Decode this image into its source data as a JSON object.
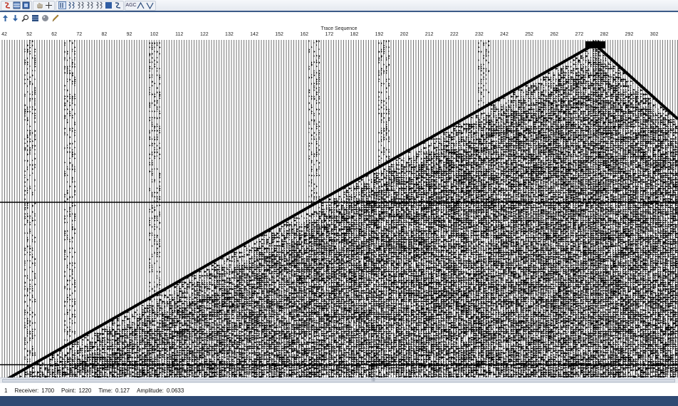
{
  "toolbar_top": {
    "items": [
      {
        "name": "seismic-display-icon",
        "kind": "icon"
      },
      {
        "name": "table-view-icon",
        "kind": "icon"
      },
      {
        "name": "data-view-icon",
        "kind": "icon"
      },
      {
        "name": "pan-hand-icon",
        "kind": "icon"
      },
      {
        "name": "crosshair-icon",
        "kind": "icon"
      },
      {
        "name": "wiggle-mode-1-icon",
        "kind": "icon"
      },
      {
        "name": "wiggle-mode-2-icon",
        "kind": "icon"
      },
      {
        "name": "wiggle-mode-3-icon",
        "kind": "icon"
      },
      {
        "name": "wiggle-mode-4-icon",
        "kind": "icon"
      },
      {
        "name": "wiggle-mode-5-icon",
        "kind": "icon"
      },
      {
        "name": "wiggle-mode-6-icon",
        "kind": "icon"
      },
      {
        "name": "wiggle-mode-7-icon",
        "kind": "icon"
      },
      {
        "name": "agc-icon",
        "kind": "icon"
      },
      {
        "name": "peak-icon",
        "kind": "icon"
      },
      {
        "name": "trough-icon",
        "kind": "icon"
      }
    ],
    "agc_label": "AGC"
  },
  "toolbar_second": {
    "items": [
      {
        "name": "increase-gain-icon"
      },
      {
        "name": "decrease-gain-icon"
      },
      {
        "name": "zoom-icon"
      },
      {
        "name": "layers-icon"
      },
      {
        "name": "palette-icon"
      },
      {
        "name": "pencil-icon"
      }
    ]
  },
  "plot": {
    "axis_title": "Trace Sequence",
    "tick_labels": [
      "42",
      "52",
      "62",
      "72",
      "82",
      "92",
      "102",
      "112",
      "122",
      "132",
      "142",
      "152",
      "162",
      "172",
      "182",
      "192",
      "202",
      "212",
      "222",
      "232",
      "242",
      "252",
      "262",
      "272",
      "282",
      "292",
      "302"
    ],
    "colors": {
      "trace": "#000000",
      "background": "#ffffff"
    }
  },
  "status": {
    "index": "1",
    "receiver_label": "Receiver:",
    "receiver_value": "1700",
    "point_label": "Point:",
    "point_value": "1220",
    "time_label": "Time:",
    "time_value": "0.127",
    "amplitude_label": "Amplitude:",
    "amplitude_value": "0.0633"
  },
  "scrollbar": {
    "grip": "|||"
  }
}
